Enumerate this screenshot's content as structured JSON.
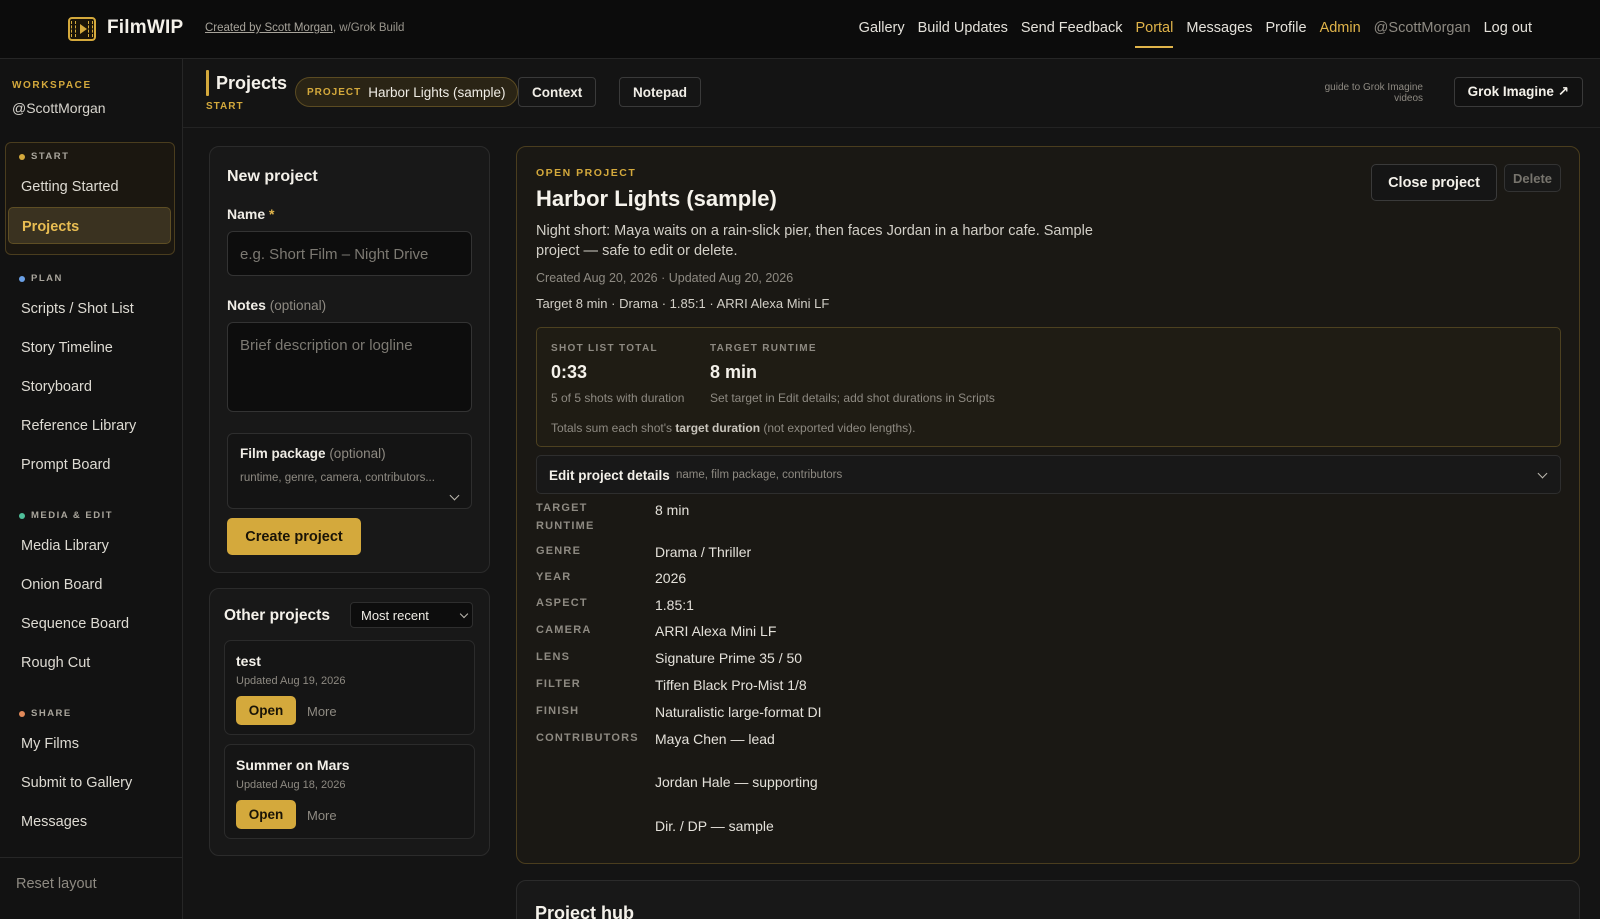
{
  "app": {
    "brand": "FilmWIP",
    "credit_link": "Created by Scott Morgan",
    "credit_rest": ", w/Grok Build"
  },
  "nav": {
    "gallery": "Gallery",
    "build_updates": "Build Updates",
    "send_feedback": "Send Feedback",
    "portal": "Portal",
    "messages": "Messages",
    "profile": "Profile",
    "admin": "Admin",
    "handle": "@ScottMorgan",
    "logout": "Log out"
  },
  "sidebar": {
    "workspace_label": "WORKSPACE",
    "workspace_handle": "@ScottMorgan",
    "sections": {
      "start": "START",
      "plan": "PLAN",
      "media": "MEDIA & EDIT",
      "share": "SHARE"
    },
    "dot_colors": {
      "start": "#d4a93c",
      "plan": "#6aa0e6",
      "media": "#4fbf9a",
      "share": "#e28a5a"
    },
    "items": {
      "getting_started": "Getting Started",
      "projects": "Projects",
      "scripts": "Scripts / Shot List",
      "story_timeline": "Story Timeline",
      "storyboard": "Storyboard",
      "reference_library": "Reference Library",
      "prompt_board": "Prompt Board",
      "media_library": "Media Library",
      "onion_board": "Onion Board",
      "sequence_board": "Sequence Board",
      "rough_cut": "Rough Cut",
      "my_films": "My Films",
      "submit_gallery": "Submit to Gallery",
      "messages": "Messages"
    },
    "reset_layout": "Reset layout"
  },
  "header": {
    "title": "Projects",
    "subtitle": "START",
    "project_label": "PROJECT",
    "project_value": "Harbor Lights (sample)",
    "context_btn": "Context",
    "notepad_btn": "Notepad",
    "grok_guide_1": "guide to Grok Imagine",
    "grok_guide_2": "videos",
    "grok_btn": "Grok Imagine ↗"
  },
  "new_project": {
    "title": "New project",
    "name_label": "Name",
    "name_required": "*",
    "name_placeholder": "e.g. Short Film – Night Drive",
    "notes_label": "Notes",
    "notes_optional": "(optional)",
    "notes_placeholder": "Brief description or logline",
    "film_package_label": "Film package",
    "film_package_optional": "(optional)",
    "film_package_hint": "runtime, genre, camera, contributors...",
    "create_btn": "Create project"
  },
  "other_projects": {
    "title": "Other projects",
    "sort_value": "Most recent",
    "cards": [
      {
        "name": "test",
        "updated": "Updated Aug 19, 2026",
        "open": "Open",
        "more": "More"
      },
      {
        "name": "Summer on Mars",
        "updated": "Updated Aug 18, 2026",
        "open": "Open",
        "more": "More"
      }
    ]
  },
  "open_project": {
    "eyebrow": "OPEN PROJECT",
    "name": "Harbor Lights (sample)",
    "description": "Night short: Maya waits on a rain-slick pier, then faces Jordan in a harbor cafe. Sample project — safe to edit or delete.",
    "created": "Created Aug 20, 2026 · Updated Aug 20, 2026",
    "summary": "Target 8 min · Drama · 1.85:1 · ARRI Alexa Mini LF",
    "close_btn": "Close project",
    "delete_btn": "Delete",
    "stats": {
      "shot_label": "SHOT LIST TOTAL",
      "shot_value": "0:33",
      "shot_hint": "5 of 5 shots with duration",
      "runtime_label": "TARGET RUNTIME",
      "runtime_value": "8 min",
      "runtime_hint": "Set target in Edit details; add shot durations in Scripts",
      "note_pre": "Totals sum each shot's ",
      "note_bold": "target duration",
      "note_post": " (not exported video lengths)."
    },
    "edit_title": "Edit project details",
    "edit_hint": "name, film package, contributors",
    "details": {
      "target_runtime_label_1": "TARGET",
      "target_runtime_label_2": "RUNTIME",
      "target_runtime": "8 min",
      "genre_label": "GENRE",
      "genre": "Drama / Thriller",
      "year_label": "YEAR",
      "year": "2026",
      "aspect_label": "ASPECT",
      "aspect": "1.85:1",
      "camera_label": "CAMERA",
      "camera": "ARRI Alexa Mini LF",
      "lens_label": "LENS",
      "lens": "Signature Prime 35 / 50",
      "filter_label": "FILTER",
      "filter": "Tiffen Black Pro-Mist 1/8",
      "finish_label": "FINISH",
      "finish": "Naturalistic large-format DI",
      "contributors_label": "CONTRIBUTORS",
      "contributors": [
        "Maya Chen — lead",
        "Jordan Hale — supporting",
        "Dir. / DP — sample"
      ]
    }
  },
  "hub": {
    "title": "Project hub"
  }
}
